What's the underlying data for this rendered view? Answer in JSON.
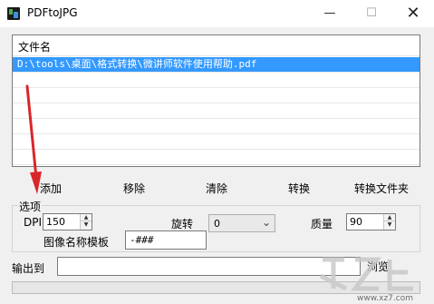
{
  "window": {
    "title": "PDFtoJPG",
    "minimize_glyph": "—",
    "maximize_glyph": "☐",
    "close_glyph": "✕"
  },
  "file_list": {
    "header": "文件名",
    "rows": [
      "D:\\tools\\桌面\\格式转换\\微讲师软件使用帮助.pdf",
      "",
      "",
      "",
      "",
      "",
      ""
    ]
  },
  "actions": {
    "add": "添加",
    "remove": "移除",
    "clear": "清除",
    "convert": "转换",
    "convert_folder": "转换文件夹"
  },
  "options": {
    "legend": "选项",
    "dpi_label": "DPI",
    "dpi_value": "150",
    "rotate_label": "旋转",
    "rotate_value": "0",
    "quality_label": "质量",
    "quality_value": "90",
    "template_label": "图像名称模板",
    "template_value": "-###"
  },
  "output": {
    "label": "输出到",
    "value": "",
    "browse": "浏览"
  },
  "progress": 0,
  "colors": {
    "selection": "#3399ff",
    "annotation_arrow": "#d9262a"
  },
  "watermark": {
    "text": "www.xz7.com"
  }
}
